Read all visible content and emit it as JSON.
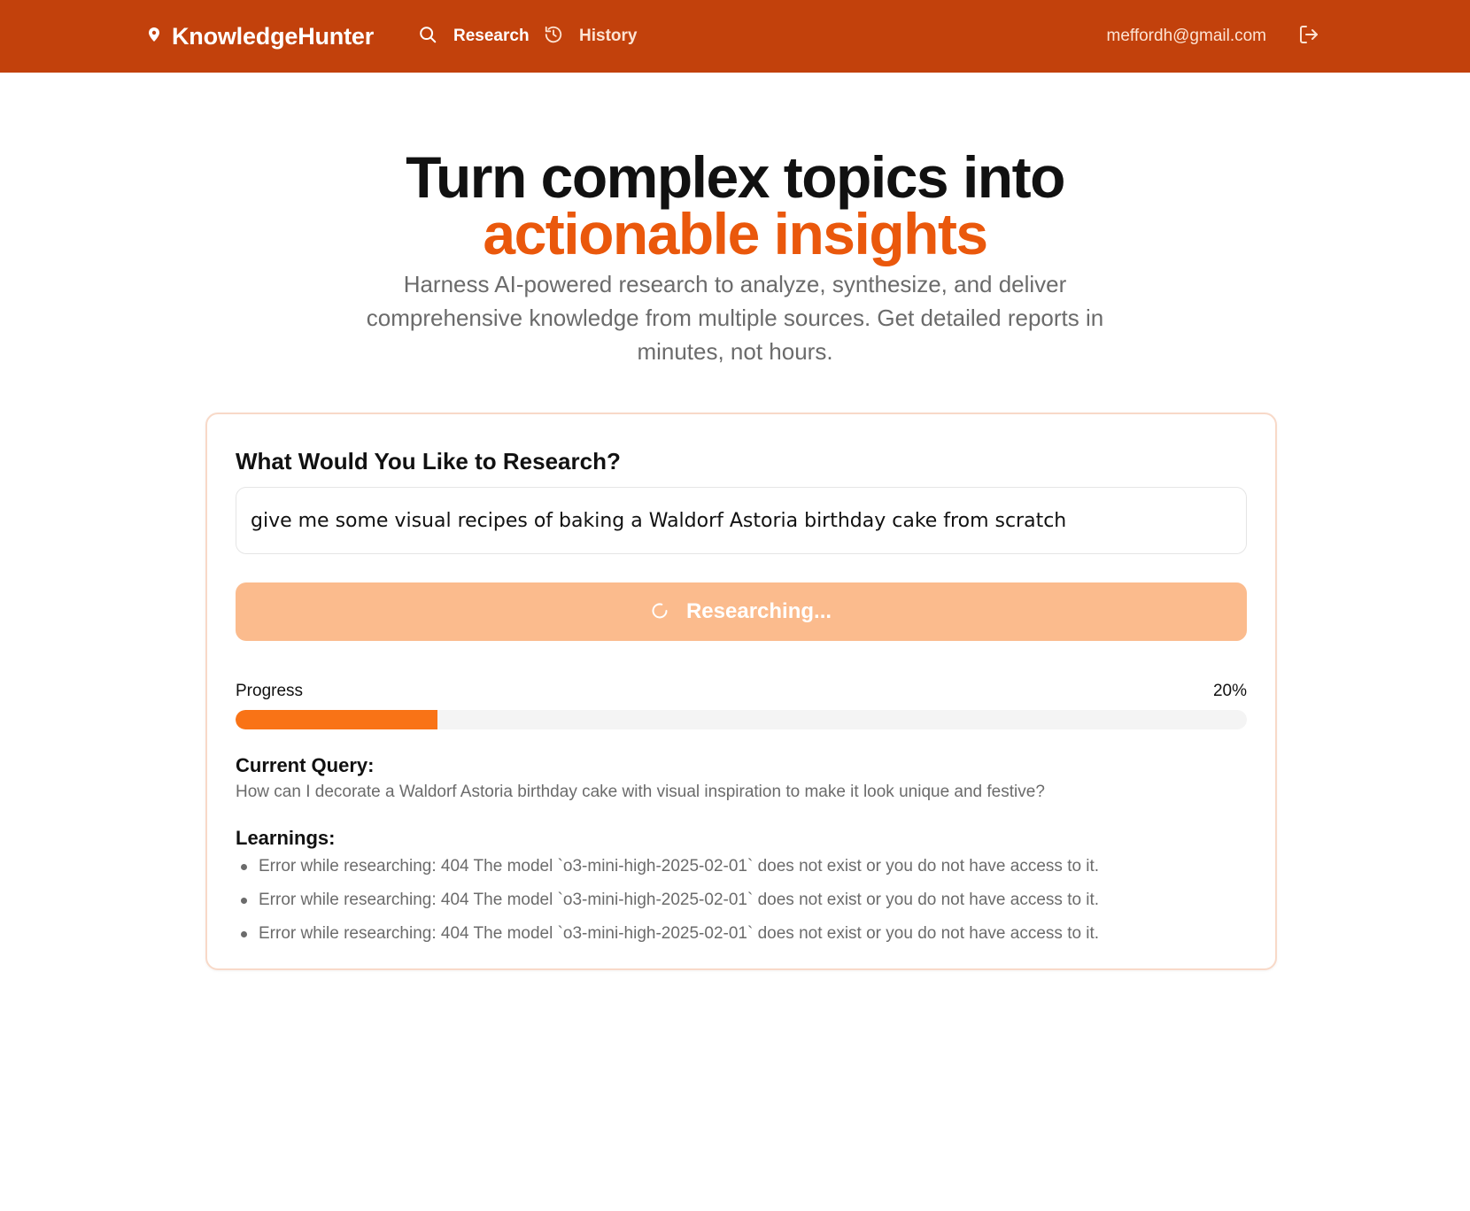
{
  "header": {
    "brand": "KnowledgeHunter",
    "nav": [
      {
        "label": "Research",
        "icon": "search-icon",
        "active": true
      },
      {
        "label": "History",
        "icon": "history-icon",
        "active": false
      }
    ],
    "user_email": "meffordh@gmail.com",
    "logout_icon": "logout-icon"
  },
  "hero": {
    "title_line1": "Turn complex topics into",
    "title_line2": "actionable insights",
    "subtitle": "Harness AI-powered research to analyze, synthesize, and deliver comprehensive knowledge from multiple sources. Get detailed reports in minutes, not hours."
  },
  "research_card": {
    "title": "What Would You Like to Research?",
    "query_value": "give me some visual recipes of baking a Waldorf Astoria birthday cake from scratch",
    "button_label": "Researching...",
    "progress_label": "Progress",
    "progress_text": "20%",
    "progress_fraction": 0.2,
    "current_query_heading": "Current Query:",
    "current_query": "How can I decorate a Waldorf Astoria birthday cake with visual inspiration to make it look unique and festive?",
    "learnings_heading": "Learnings:",
    "learnings": [
      "Error while researching: 404 The model `o3-mini-high-2025-02-01` does not exist or you do not have access to it.",
      "Error while researching: 404 The model `o3-mini-high-2025-02-01` does not exist or you do not have access to it.",
      "Error while researching: 404 The model `o3-mini-high-2025-02-01` does not exist or you do not have access to it."
    ]
  },
  "colors": {
    "header_bg": "#c2410c",
    "accent": "#ea580c",
    "button_disabled": "#fbbb8d",
    "progress_fill": "#f97316"
  }
}
